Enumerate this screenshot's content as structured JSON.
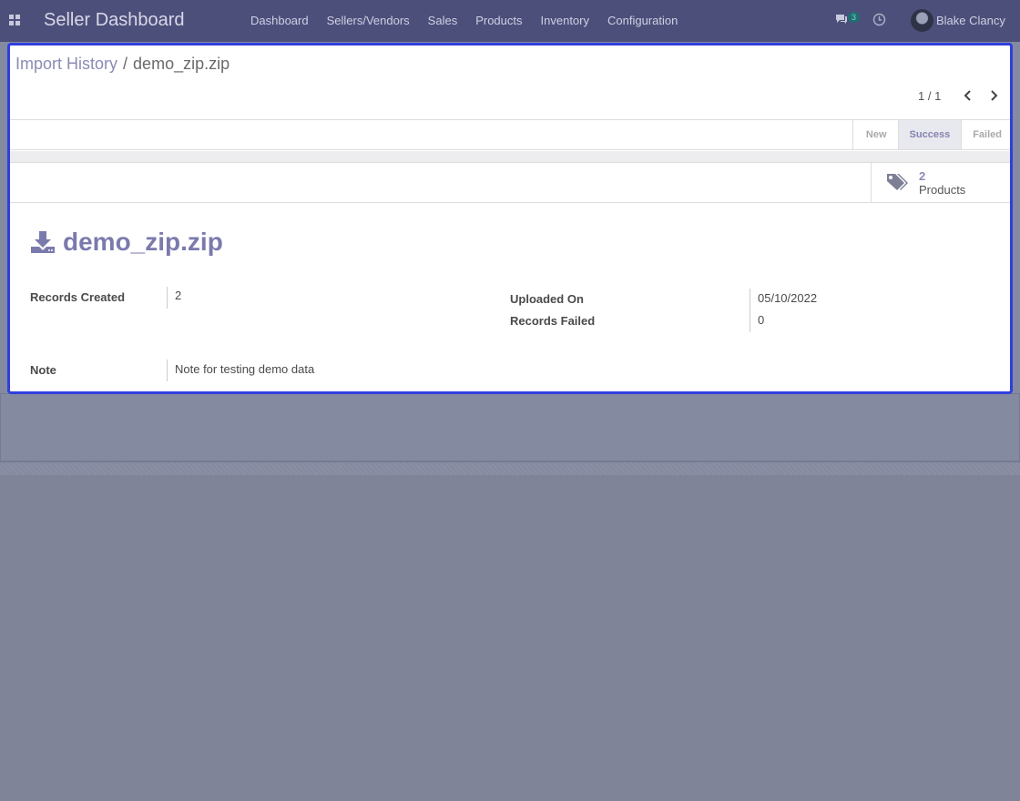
{
  "app": {
    "title": "Seller Dashboard"
  },
  "menu": [
    "Dashboard",
    "Sellers/Vendors",
    "Sales",
    "Products",
    "Inventory",
    "Configuration"
  ],
  "systray": {
    "message_count": "3",
    "user_name": "Blake Clancy"
  },
  "breadcrumb": {
    "parent": "Import History",
    "separator": "/",
    "current": "demo_zip.zip"
  },
  "pager": {
    "text": "1 / 1"
  },
  "stages": [
    {
      "label": "New",
      "active": false
    },
    {
      "label": "Success",
      "active": true
    },
    {
      "label": "Failed",
      "active": false
    }
  ],
  "smart_button": {
    "value": "2",
    "label": "Products",
    "icon": "tags-icon"
  },
  "record": {
    "title": "demo_zip.zip",
    "title_icon": "download-icon",
    "records_created_label": "Records Created",
    "records_created": "2",
    "uploaded_on_label": "Uploaded On",
    "uploaded_on": "05/10/2022",
    "records_failed_label": "Records Failed",
    "records_failed": "0",
    "note_label": "Note",
    "note": "Note for testing demo data"
  },
  "colors": {
    "navbar": "#4d4f7b",
    "accent": "#7b7aad",
    "focus_border": "#2f3fe0"
  }
}
